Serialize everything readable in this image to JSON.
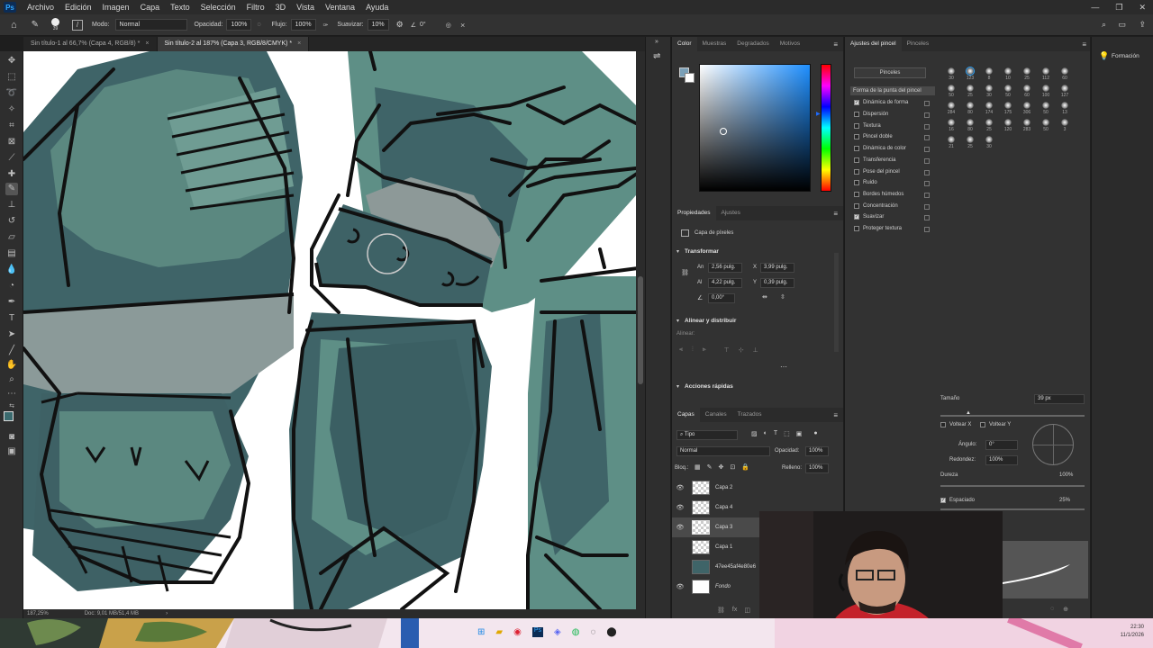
{
  "menubar": {
    "logo": "Ps",
    "items": [
      "Archivo",
      "Edición",
      "Imagen",
      "Capa",
      "Texto",
      "Selección",
      "Filtro",
      "3D",
      "Vista",
      "Ventana",
      "Ayuda"
    ]
  },
  "options": {
    "brush_size": "39",
    "mode_label": "Modo:",
    "mode_value": "Normal",
    "opacity_label": "Opacidad:",
    "opacity_value": "100%",
    "flow_label": "Flujo:",
    "flow_value": "100%",
    "smooth_label": "Suavizar:",
    "smooth_value": "10%",
    "angle_value": "0°"
  },
  "tabs": [
    {
      "label": "Sin título-1 al 66,7% (Capa 4, RGB/8) *",
      "active": false
    },
    {
      "label": "Sin título-2 al 187% (Capa 3, RGB/8/CMYK) *",
      "active": true
    }
  ],
  "status": {
    "zoom": "187,25%",
    "doc": "Doc: 9,01 MB/51,4 MB"
  },
  "color_panel": {
    "tabs": [
      "Color",
      "Muestras",
      "Degradados",
      "Motivos"
    ]
  },
  "properties": {
    "tabs": [
      "Propiedades",
      "Ajustes"
    ],
    "kind": "Capa de píxeles",
    "transform_title": "Transformar",
    "w_label": "An",
    "w_value": "2,56 pulg.",
    "h_label": "Al",
    "h_value": "4,22 pulg.",
    "x_label": "X",
    "x_value": "3,99 pulg.",
    "y_label": "Y",
    "y_value": "0,39 pulg.",
    "angle_value": "0,00°",
    "align_title": "Alinear y distribuir",
    "align_label": "Alinear:",
    "quick_title": "Acciones rápidas"
  },
  "layers_panel": {
    "tabs": [
      "Capas",
      "Canales",
      "Trazados"
    ],
    "filter_label": "Tipo",
    "blend_mode": "Normal",
    "opacity_label": "Opacidad:",
    "opacity_value": "100%",
    "lock_label": "Bloq.:",
    "fill_label": "Relleno:",
    "fill_value": "100%",
    "layers": [
      {
        "name": "Capa 2",
        "visible": true,
        "selected": false
      },
      {
        "name": "Capa 4",
        "visible": true,
        "selected": false
      },
      {
        "name": "Capa 3",
        "visible": true,
        "selected": true
      },
      {
        "name": "Capa 1",
        "visible": false,
        "selected": false
      },
      {
        "name": "47ee45af4e80e6",
        "visible": false,
        "selected": false
      },
      {
        "name": "Fondo",
        "visible": true,
        "selected": false
      }
    ]
  },
  "brush_settings": {
    "tabs": [
      "Ajustes del pincel",
      "Pinceles"
    ],
    "brushes_button": "Pinceles",
    "tip_shape": "Forma de la punta del pincel",
    "options": [
      {
        "label": "Dinámica de forma",
        "on": true
      },
      {
        "label": "Dispersión",
        "on": false
      },
      {
        "label": "Textura",
        "on": false
      },
      {
        "label": "Pincel doble",
        "on": false
      },
      {
        "label": "Dinámica de color",
        "on": false
      },
      {
        "label": "Transferencia",
        "on": false
      },
      {
        "label": "Pose del pincel",
        "on": false
      },
      {
        "label": "Ruido",
        "on": false
      },
      {
        "label": "Bordes húmedos",
        "on": false
      },
      {
        "label": "Concentración",
        "on": false
      },
      {
        "label": "Suavizar",
        "on": true
      },
      {
        "label": "Proteger textura",
        "on": false
      }
    ],
    "brush_sizes": [
      "30",
      "123",
      "8",
      "10",
      "25",
      "112",
      "60",
      "50",
      "25",
      "30",
      "50",
      "60",
      "100",
      "127",
      "284",
      "80",
      "174",
      "175",
      "306",
      "50",
      "13",
      "16",
      "80",
      "25",
      "120",
      "283",
      "50",
      "3",
      "21",
      "25",
      "30"
    ],
    "size_label": "Tamaño",
    "size_value": "39 px",
    "flip_x": "Voltear X",
    "flip_y": "Voltear Y",
    "angle_label": "Ángulo:",
    "angle_value": "0°",
    "round_label": "Redondez:",
    "round_value": "100%",
    "hardness_label": "Dureza",
    "hardness_value": "100%",
    "spacing_label": "Espaciado",
    "spacing_value": "25%"
  },
  "learn": {
    "label": "Formación"
  },
  "clock": {
    "time": "22:30",
    "date": "11/1/2026"
  },
  "colors": {
    "accent": "#31a8ff",
    "armor_dark": "#3f6468",
    "armor_mid": "#5e8f86",
    "armor_light": "#6f9c93",
    "line": "#111111"
  }
}
